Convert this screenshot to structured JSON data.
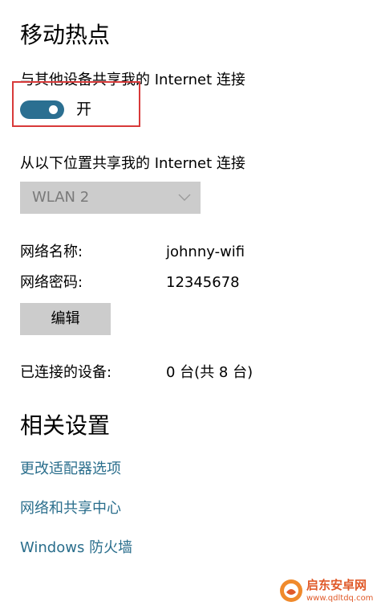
{
  "hotspot": {
    "title": "移动热点",
    "share_label": "与其他设备共享我的 Internet 连接",
    "toggle": {
      "on": true,
      "state_label": "开"
    },
    "from_label": "从以下位置共享我的 Internet 连接",
    "connection_select": {
      "selected": "WLAN 2"
    },
    "network_name": {
      "label": "网络名称:",
      "value": "johnny-wifi"
    },
    "network_password": {
      "label": "网络密码:",
      "value": "12345678"
    },
    "edit_button_label": "编辑",
    "connected_devices": {
      "label": "已连接的设备:",
      "value": "0 台(共 8 台)"
    }
  },
  "related_settings": {
    "title": "相关设置",
    "links": [
      "更改适配器选项",
      "网络和共享中心",
      "Windows 防火墙"
    ]
  },
  "watermark": {
    "title": "启东安卓网",
    "url": "www.qdltdq.com"
  },
  "colors": {
    "accent": "#2b6f91",
    "link": "#2a6e8c",
    "highlight": "#d83a3a",
    "control_bg": "#cccccc"
  }
}
